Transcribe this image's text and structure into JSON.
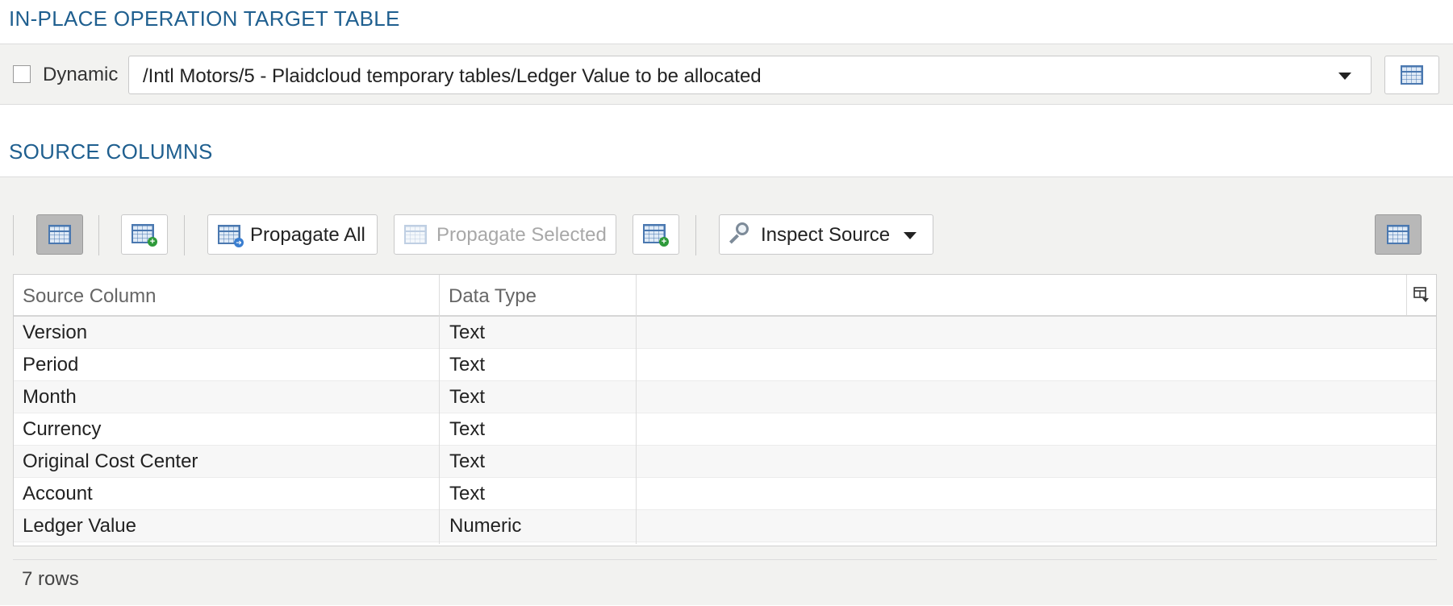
{
  "target_section": {
    "title": "IN-PLACE OPERATION TARGET TABLE",
    "dynamic_label": "Dynamic",
    "dynamic_checked": false,
    "table_path": "/Intl Motors/5 - Plaidcloud temporary tables/Ledger Value to be allocated"
  },
  "source_section": {
    "title": "SOURCE COLUMNS",
    "toolbar": {
      "propagate_all": "Propagate All",
      "propagate_selected": "Propagate Selected",
      "inspect_source": "Inspect Source"
    },
    "columns": [
      "Source Column",
      "Data Type"
    ],
    "rows": [
      {
        "source_column": "Version",
        "data_type": "Text"
      },
      {
        "source_column": "Period",
        "data_type": "Text"
      },
      {
        "source_column": "Month",
        "data_type": "Text"
      },
      {
        "source_column": "Currency",
        "data_type": "Text"
      },
      {
        "source_column": "Original Cost Center",
        "data_type": "Text"
      },
      {
        "source_column": "Account",
        "data_type": "Text"
      },
      {
        "source_column": "Ledger Value",
        "data_type": "Numeric"
      }
    ],
    "row_count": "7 rows"
  },
  "colors": {
    "section_title": "#1f5f8f",
    "panel_bg": "#f2f2f0",
    "icon_blue": "#4a78b0",
    "add_green": "#2e9a3a"
  }
}
